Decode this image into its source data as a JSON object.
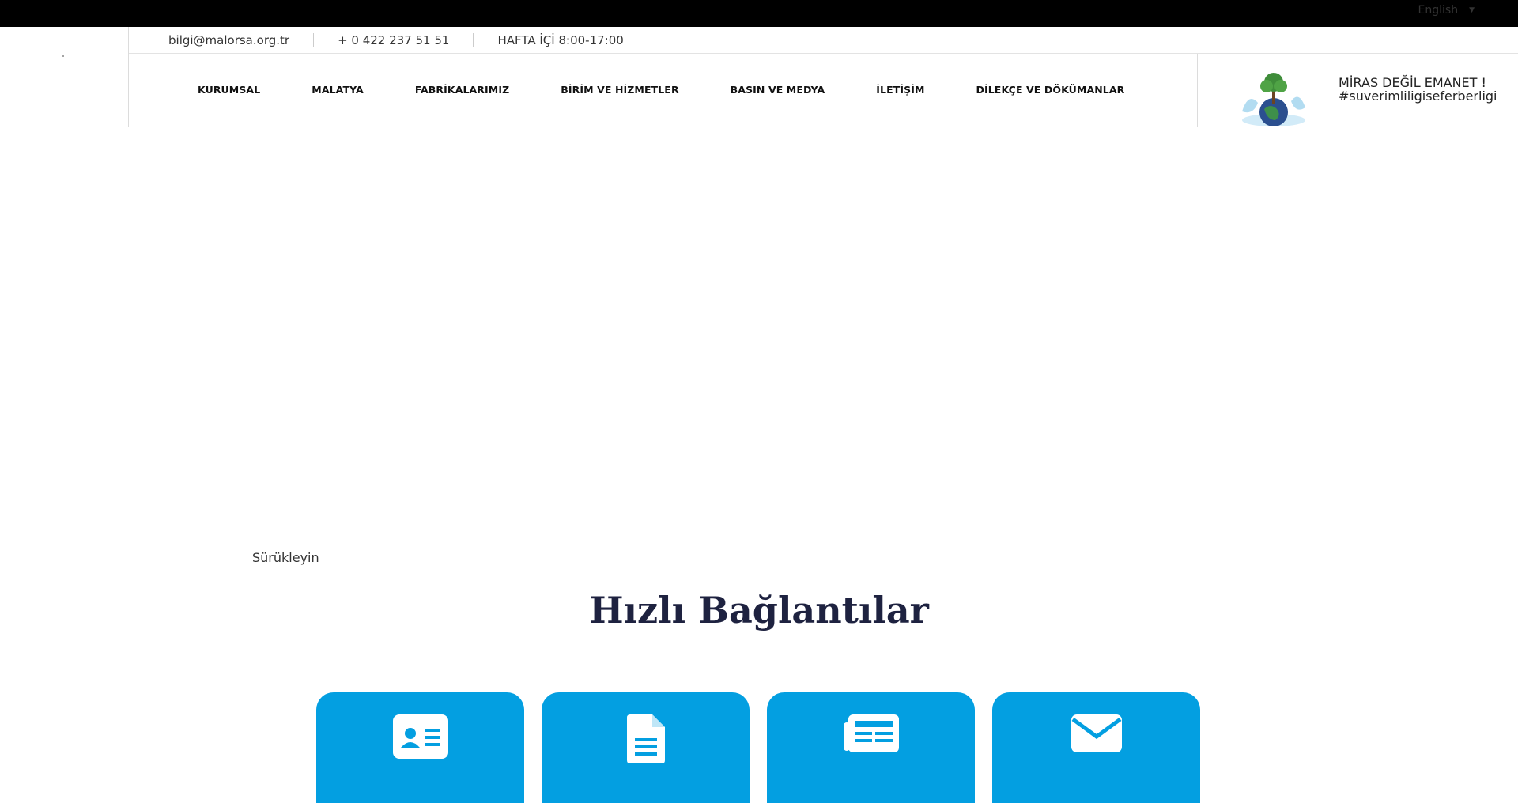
{
  "topbar": {
    "language_label": "English",
    "language_chevron_icon": "chevron-down-icon"
  },
  "contact": {
    "email": "bilgi@malorsa.org.tr",
    "phone": "+ 0 422 237 51 51",
    "hours": "HAFTA İÇİ 8:00-17:00"
  },
  "nav": {
    "items": [
      {
        "label": "KURUMSAL"
      },
      {
        "label": "MALATYA"
      },
      {
        "label": "FABRİKALARIMIZ"
      },
      {
        "label": "BİRİM VE HİZMETLER"
      },
      {
        "label": "BASIN VE MEDYA"
      },
      {
        "label": "İLETİŞİM"
      },
      {
        "label": "DİLEKÇE VE DÖKÜMANLAR"
      }
    ]
  },
  "slogan": {
    "line1": "MİRAS DEĞİL EMANET !",
    "line2": "#suverimliligiseferberligi"
  },
  "slider": {
    "drag_label": "Sürükleyin"
  },
  "quick_links": {
    "title": "Hızlı Bağlantılar",
    "cards": [
      {
        "icon": "id-card-icon"
      },
      {
        "icon": "document-icon"
      },
      {
        "icon": "newspaper-icon"
      },
      {
        "icon": "envelope-icon"
      }
    ]
  },
  "colors": {
    "topbar": "#000000",
    "card_blue": "#039fe1",
    "title_navy": "#1e2240"
  }
}
